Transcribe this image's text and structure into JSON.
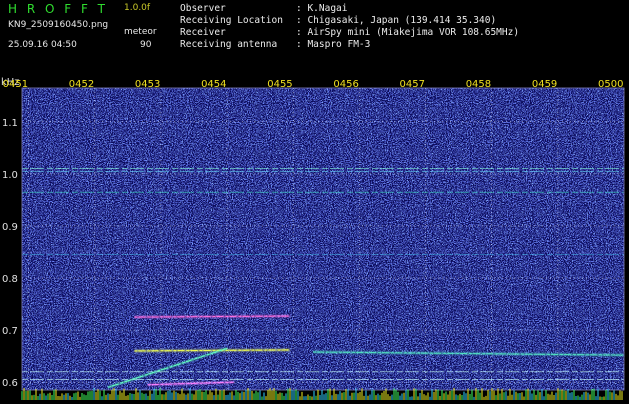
{
  "header": {
    "brand": "H R O F F T",
    "version": "1.0.0f",
    "filename": "KN9_2509160450.png",
    "mode_label": "meteor",
    "datetime": "25.09.16 04:50",
    "mode_value": "90",
    "fields": [
      {
        "label": "Observer",
        "value": ": K.Nagai"
      },
      {
        "label": "Receiving Location",
        "value": ": Chigasaki, Japan (139.414 35.340)"
      },
      {
        "label": "Receiver",
        "value": ": AirSpy mini (Miakejima VOR 108.65MHz)"
      },
      {
        "label": "Receiving antenna",
        "value": ": Maspro FM-3"
      }
    ]
  },
  "colors": {
    "background": "#0a0a5a",
    "noise_blue": "#2a3cc8",
    "grid": "#ffffff",
    "time_labels": "#f0e020",
    "freq_labels": "#e0e0e0",
    "carrier": "#a0ffd0"
  },
  "chart_data": {
    "type": "heatmap",
    "title": "",
    "ylabel": "kHz",
    "y_ticks": [
      "1.1",
      "1.0",
      "0.9",
      "0.8",
      "0.7",
      "0.6"
    ],
    "y_tick_values": [
      1.1,
      1.0,
      0.9,
      0.8,
      0.7,
      0.6
    ],
    "ylim": [
      0.585,
      1.165
    ],
    "x_ticks": [
      "0451",
      "0452",
      "0453",
      "0454",
      "0455",
      "0456",
      "0457",
      "0458",
      "0459",
      "0500"
    ],
    "x_tick_values": [
      0,
      1,
      2,
      3,
      4,
      5,
      6,
      7,
      8,
      9
    ],
    "xlim": [
      -0.1,
      9.0
    ],
    "carriers": [
      {
        "freq": 1.01,
        "t_start": -0.1,
        "t_end": 9.0,
        "color": "#7ef0d8"
      },
      {
        "freq": 1.005,
        "t_start": -0.1,
        "t_end": 9.0,
        "color": "#60c8f0"
      },
      {
        "freq": 0.965,
        "t_start": -0.1,
        "t_end": 9.0,
        "color": "#40d8c8"
      },
      {
        "freq": 0.845,
        "t_start": -0.1,
        "t_end": 9.0,
        "color": "#40b8e8"
      },
      {
        "freq": 0.62,
        "t_start": -0.1,
        "t_end": 9.0,
        "color": "#c8ffff"
      },
      {
        "freq": 0.605,
        "t_start": -0.1,
        "t_end": 9.0,
        "color": "#c8ffff"
      }
    ],
    "echoes": [
      {
        "t_start": 1.6,
        "t_end": 3.95,
        "freq_start": 0.725,
        "freq_end": 0.727,
        "color": "#ff70e0"
      },
      {
        "t_start": 1.6,
        "t_end": 3.95,
        "freq_start": 0.66,
        "freq_end": 0.662,
        "color": "#f0ff50"
      },
      {
        "t_start": 1.2,
        "t_end": 3.0,
        "freq_start": 0.59,
        "freq_end": 0.665,
        "color": "#60ffc0"
      },
      {
        "t_start": 1.8,
        "t_end": 3.1,
        "freq_start": 0.595,
        "freq_end": 0.6,
        "color": "#ff80ff"
      },
      {
        "t_start": 4.3,
        "t_end": 9.0,
        "freq_start": 0.658,
        "freq_end": 0.652,
        "color": "#50e0c0"
      }
    ]
  }
}
